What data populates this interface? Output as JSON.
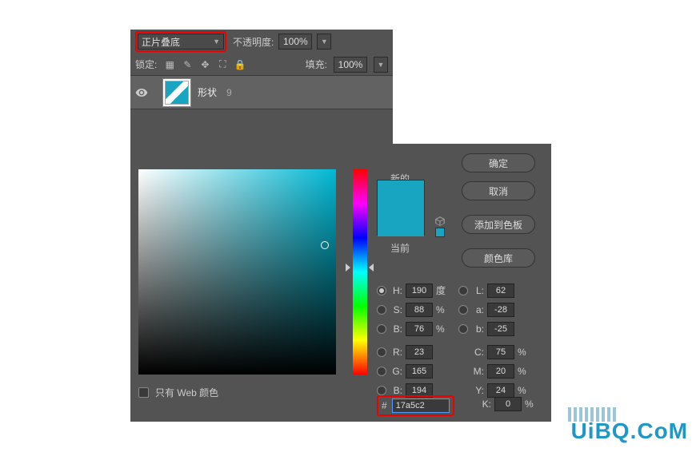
{
  "layers": {
    "blend_mode": "正片叠底",
    "opacity_label": "不透明度:",
    "opacity_value": "100%",
    "lock_label": "锁定:",
    "fill_label": "填充:",
    "fill_value": "100%",
    "layer_name": "形状",
    "layer_number": "9"
  },
  "picker": {
    "new_label": "新的",
    "current_label": "当前",
    "btn_ok": "确定",
    "btn_cancel": "取消",
    "btn_add": "添加到色板",
    "btn_lib": "颜色库",
    "fields": {
      "H": {
        "label": "H:",
        "value": "190",
        "unit": "度"
      },
      "S": {
        "label": "S:",
        "value": "88",
        "unit": "%"
      },
      "Bv": {
        "label": "B:",
        "value": "76",
        "unit": "%"
      },
      "L": {
        "label": "L:",
        "value": "62"
      },
      "a": {
        "label": "a:",
        "value": "-28"
      },
      "b": {
        "label": "b:",
        "value": "-25"
      },
      "R": {
        "label": "R:",
        "value": "23"
      },
      "G": {
        "label": "G:",
        "value": "165"
      },
      "Bb": {
        "label": "B:",
        "value": "194"
      },
      "C": {
        "label": "C:",
        "value": "75",
        "unit": "%"
      },
      "M": {
        "label": "M:",
        "value": "20",
        "unit": "%"
      },
      "Y": {
        "label": "Y:",
        "value": "24",
        "unit": "%"
      },
      "K": {
        "label": "K:",
        "value": "0",
        "unit": "%"
      }
    },
    "hex_label": "#",
    "hex_value": "17a5c2",
    "webonly_label": "只有 Web 颜色"
  },
  "watermark": "UiBQ.CoM"
}
